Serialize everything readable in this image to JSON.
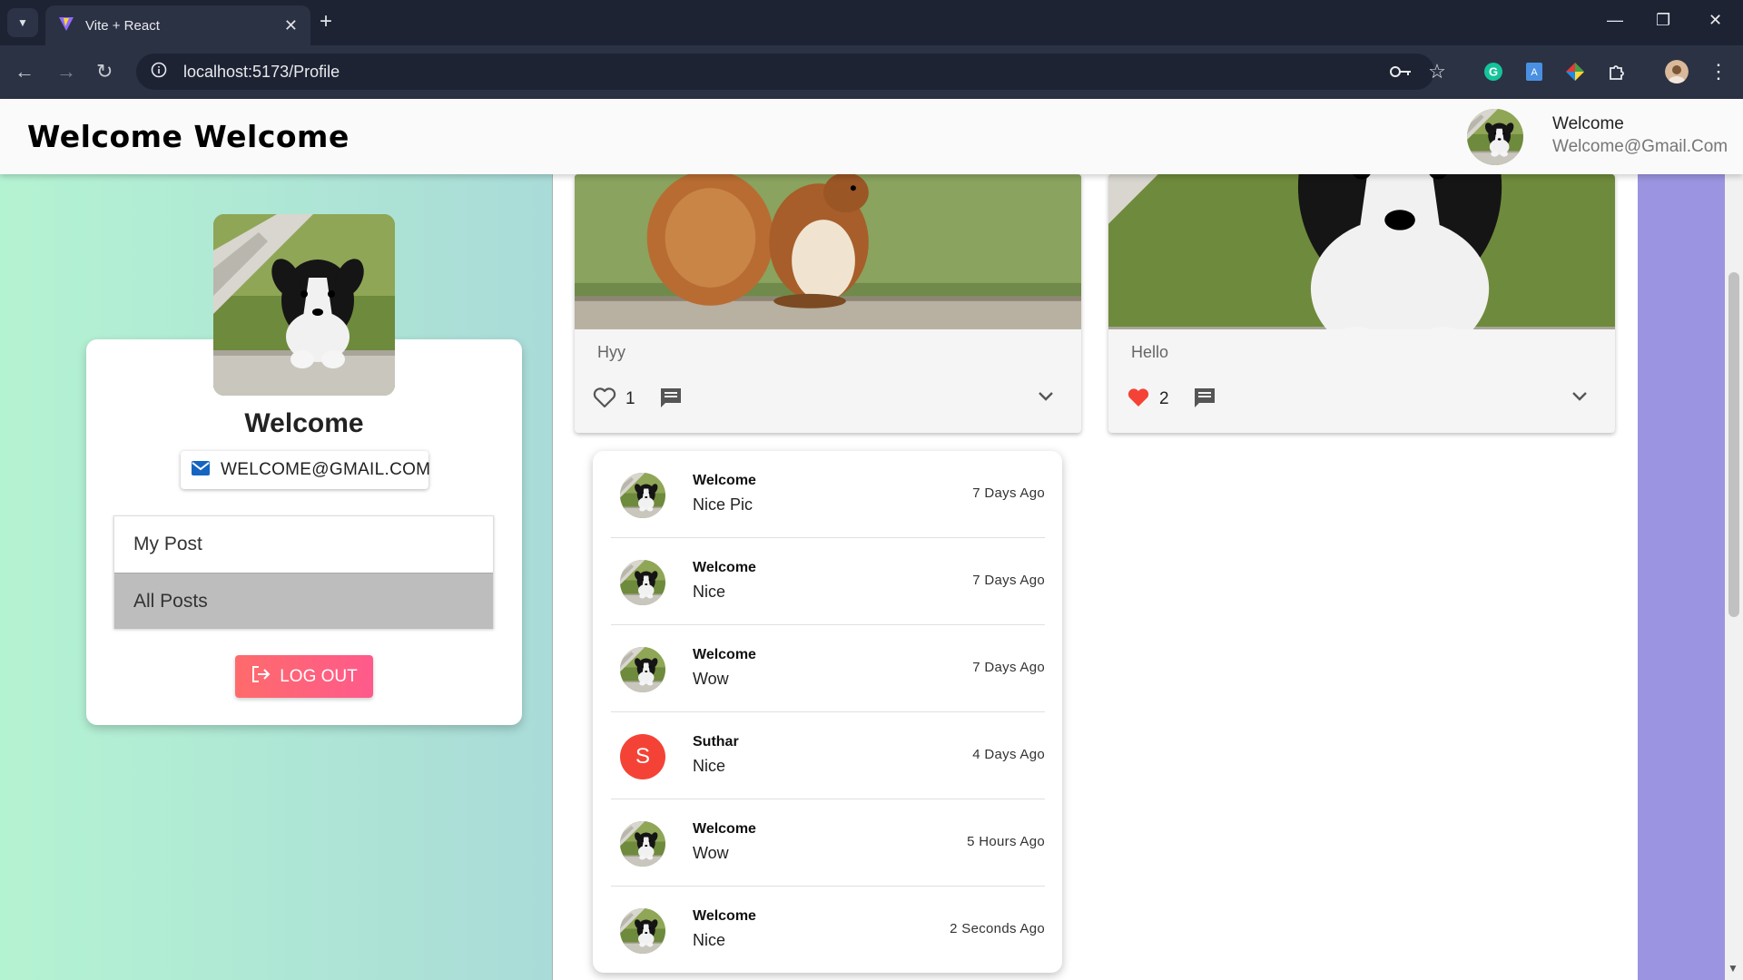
{
  "browser": {
    "tab_title": "Vite + React",
    "url": "localhost:5173/Profile"
  },
  "header": {
    "brand": "Welcome Welcome",
    "user_name": "Welcome",
    "user_email": "Welcome@Gmail.Com"
  },
  "profile": {
    "name": "Welcome",
    "email": "WELCOME@GMAIL.COM",
    "menu": [
      {
        "label": "My Post",
        "active": false
      },
      {
        "label": "All Posts",
        "active": true
      }
    ],
    "logout_label": "LOG OUT"
  },
  "posts": [
    {
      "caption": "Hyy",
      "likes": "1",
      "liked": false,
      "image": "squirrel"
    },
    {
      "caption": "Hello",
      "likes": "2",
      "liked": true,
      "image": "puppy"
    }
  ],
  "comments": [
    {
      "author": "Welcome",
      "text": "Nice Pic",
      "time": "7 Days Ago",
      "avatar": "puppy"
    },
    {
      "author": "Welcome",
      "text": "Nice",
      "time": "7 Days Ago",
      "avatar": "puppy"
    },
    {
      "author": "Welcome",
      "text": "Wow",
      "time": "7 Days Ago",
      "avatar": "puppy"
    },
    {
      "author": "Suthar",
      "text": "Nice",
      "time": "4 Days Ago",
      "avatar": "letter",
      "letter": "S"
    },
    {
      "author": "Welcome",
      "text": "Wow",
      "time": "5 Hours Ago",
      "avatar": "puppy"
    },
    {
      "author": "Welcome",
      "text": "Nice",
      "time": "2 Seconds Ago",
      "avatar": "puppy"
    }
  ],
  "colors": {
    "accent_red": "#f44336",
    "logout_gradient_start": "#fe6b6b",
    "logout_gradient_end": "#ff5a8c",
    "liked_heart": "#f44336"
  }
}
